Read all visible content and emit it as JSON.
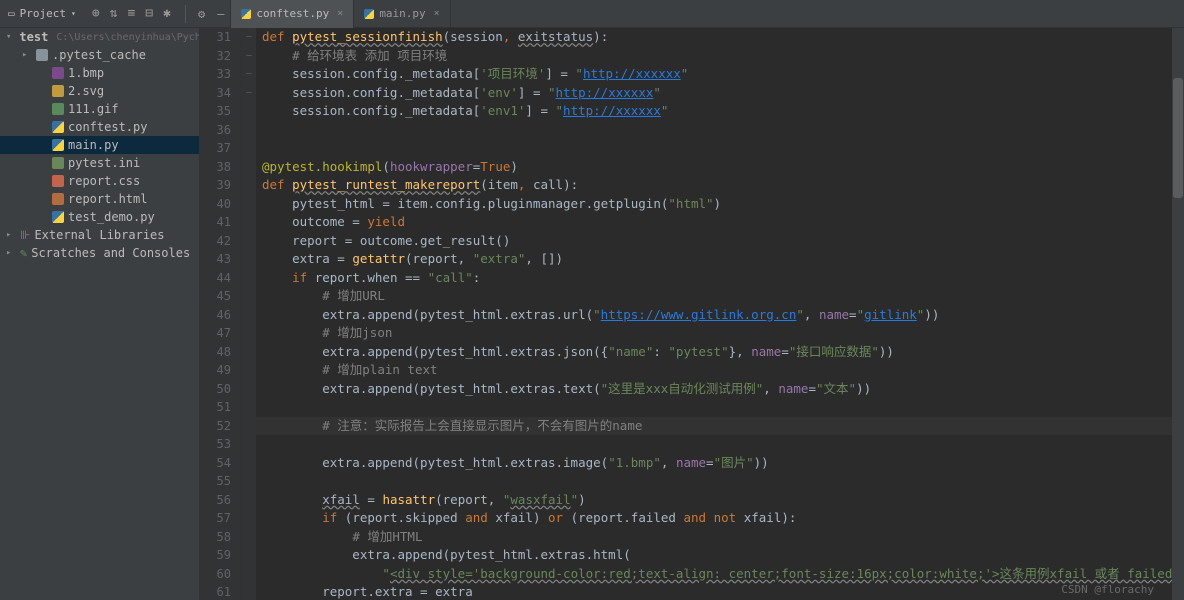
{
  "toolbar": {
    "project": "Project",
    "triangle": "▾",
    "icons": [
      "⊕",
      "⇅",
      "≡",
      "⊟",
      "✱"
    ],
    "settings": "⚙",
    "hide": "—"
  },
  "tabs": [
    {
      "name": "conftest.py",
      "active": true
    },
    {
      "name": "main.py",
      "active": false
    }
  ],
  "tree": {
    "root": {
      "chev": "▾",
      "name": "test",
      "path": "C:\\Users\\chenyinhua\\Pycharm"
    },
    "items": [
      {
        "chev": "▸",
        "icon": "dir",
        "name": ".pytest_cache",
        "ind": "i2"
      },
      {
        "icon": "f-bmp",
        "name": "1.bmp",
        "ind": "i3"
      },
      {
        "icon": "f-svg",
        "name": "2.svg",
        "ind": "i3"
      },
      {
        "icon": "f-gif",
        "name": "111.gif",
        "ind": "i3"
      },
      {
        "icon": "f-py",
        "name": "conftest.py",
        "ind": "i3"
      },
      {
        "icon": "f-py",
        "name": "main.py",
        "ind": "i3",
        "sel": true
      },
      {
        "icon": "f-ini",
        "name": "pytest.ini",
        "ind": "i3"
      },
      {
        "icon": "f-css",
        "name": "report.css",
        "ind": "i3"
      },
      {
        "icon": "f-html",
        "name": "report.html",
        "ind": "i3"
      },
      {
        "icon": "f-py",
        "name": "test_demo.py",
        "ind": "i3"
      }
    ],
    "ext": {
      "chev": "▸",
      "name": "External Libraries"
    },
    "scr": {
      "chev": "▸",
      "name": "Scratches and Consoles"
    }
  },
  "gutter": {
    "start": 31,
    "end": 61
  },
  "fold": {
    "31": "—",
    "39": "—",
    "44": "—",
    "56": "—"
  },
  "code": [
    {
      "n": 31,
      "html": "<span class='kw'>def</span> <span class='fn ul'>pytest_sessionfinish</span>(session<span class='kw'>,</span> <span class='par ul'>exitstatus</span>):",
      "ind": 0
    },
    {
      "n": 32,
      "html": "<span class='cmt'># 给环境表 添加 项目环境</span>",
      "ind": 2
    },
    {
      "n": 33,
      "html": "session.config._metadata[<span class='str'>'项目环境'</span>] = <span class='str'>\"</span><span class='lnk'>http://xxxxxx</span><span class='str'>\"</span>",
      "ind": 2
    },
    {
      "n": 34,
      "html": "session.config._metadata[<span class='str'>'env'</span>] = <span class='str'>\"</span><span class='lnk'>http://xxxxxx</span><span class='str'>\"</span>",
      "ind": 2
    },
    {
      "n": 35,
      "html": "session.config._metadata[<span class='str'>'env1'</span>] = <span class='str'>\"</span><span class='lnk'>http://xxxxxx</span><span class='str'>\"</span>",
      "ind": 2
    },
    {
      "n": 36,
      "html": "",
      "ind": 0
    },
    {
      "n": 37,
      "html": "",
      "ind": 0
    },
    {
      "n": 38,
      "html": "<span class='dec'>@pytest.hookimpl</span>(<span class='pn'>hookwrapper</span>=<span class='kw'>True</span>)",
      "ind": 0
    },
    {
      "n": 39,
      "html": "<span class='kw'>def</span> <span class='fn ul'>pytest_runtest_makereport</span>(item<span class='kw'>,</span> call):",
      "ind": 0
    },
    {
      "n": 40,
      "html": "pytest_html = item.config.pluginmanager.getplugin(<span class='str'>\"html\"</span>)",
      "ind": 2
    },
    {
      "n": 41,
      "html": "outcome = <span class='kw'>yield</span>",
      "ind": 2
    },
    {
      "n": 42,
      "html": "report = outcome.get_result()",
      "ind": 2
    },
    {
      "n": 43,
      "html": "extra = <span class='fn'>getattr</span>(report, <span class='str'>\"extra\"</span>, [])",
      "ind": 2
    },
    {
      "n": 44,
      "html": "<span class='kw'>if</span> report.when == <span class='str'>\"call\"</span>:",
      "ind": 2
    },
    {
      "n": 45,
      "html": "<span class='cmt'># 增加URL</span>",
      "ind": 3
    },
    {
      "n": 46,
      "html": "extra.append(pytest_html.extras.url(<span class='str'>\"</span><span class='lnk'>https://www.gitlink.org.cn</span><span class='str'>\"</span>, <span class='pn'>name</span>=<span class='str'>\"</span><span class='lnk'>gitlink</span><span class='str'>\"</span>))",
      "ind": 3
    },
    {
      "n": 47,
      "html": "<span class='cmt'># 增加json</span>",
      "ind": 3
    },
    {
      "n": 48,
      "html": "extra.append(pytest_html.extras.json({<span class='str'>\"name\"</span>: <span class='str'>\"pytest\"</span>}, <span class='pn'>name</span>=<span class='str'>\"接口响应数据\"</span>))",
      "ind": 3
    },
    {
      "n": 49,
      "html": "<span class='cmt'># 增加plain text</span>",
      "ind": 3
    },
    {
      "n": 50,
      "html": "extra.append(pytest_html.extras.text(<span class='str'>\"这里是xxx自动化测试用例\"</span>, <span class='pn'>name</span>=<span class='str'>\"文本\"</span>))",
      "ind": 3
    },
    {
      "n": 51,
      "html": "",
      "ind": 0
    },
    {
      "n": 52,
      "html": "<span class='cmt'># 注意：实际报告上会直接显示图片，不会有图片的name</span>",
      "ind": 3,
      "hl": true
    },
    {
      "n": 53,
      "html": "extra.append(pytest_html.extras.image(<span class='str'>\"1.bmp\"</span>, <span class='pn'>name</span>=<span class='str'>\"图片\"</span>))",
      "ind": 3
    },
    {
      "n": 54,
      "html": "",
      "ind": 0
    },
    {
      "n": 55,
      "html": "<span class='ul'>xfail</span> = <span class='fn'>hasattr</span>(report, <span class='str'>\"<span class='ul'>wasxfail</span>\"</span>)",
      "ind": 3
    },
    {
      "n": 56,
      "html": "<span class='kw'>if</span> (report.skipped <span class='kw'>and</span> xfail) <span class='kw'>or</span> (report.failed <span class='kw'>and not</span> xfail):",
      "ind": 3
    },
    {
      "n": 57,
      "html": "<span class='cmt'># 增加HTML</span>",
      "ind": 4
    },
    {
      "n": 58,
      "html": "extra.append(pytest_html.extras.html(",
      "ind": 4
    },
    {
      "n": 59,
      "html": "<span class='str'>\"<span class='ul'>&lt;div style='background-color:red;text-align: center;font-size:16px;color:white;'&gt;这条用例xfail 或者 failed&lt;/div&gt;</span>\"</span>))",
      "ind": 5
    },
    {
      "n": 60,
      "html": "report.extra = extra",
      "ind": 3
    },
    {
      "n": 61,
      "html": "",
      "ind": 0
    }
  ],
  "watermark": "CSDN @florachy"
}
